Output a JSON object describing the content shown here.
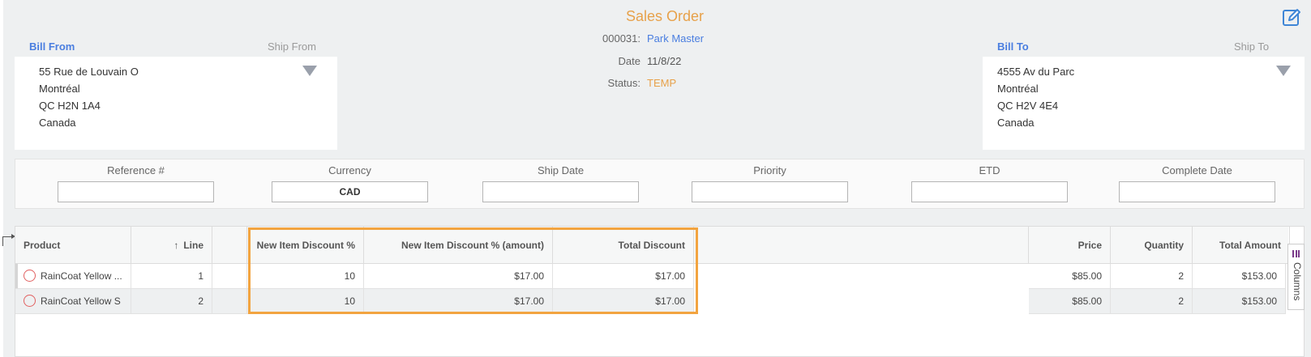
{
  "header": {
    "title": "Sales Order",
    "edit_icon": "edit-icon",
    "order_number_label": "000031:",
    "order_number_value": "Park Master",
    "date_label": "Date",
    "date_value": "11/8/22",
    "status_label": "Status:",
    "status_value": "TEMP"
  },
  "bill_from": {
    "label": "Bill From",
    "ship_from_label": "Ship From",
    "lines": [
      "55 Rue de Louvain O",
      "Montréal",
      "QC H2N 1A4",
      "Canada"
    ]
  },
  "bill_to": {
    "label": "Bill To",
    "ship_to_label": "Ship To",
    "lines": [
      "4555 Av du Parc",
      "Montréal",
      "QC H2V 4E4",
      "Canada"
    ]
  },
  "fields": {
    "reference": {
      "label": "Reference #",
      "value": ""
    },
    "currency": {
      "label": "Currency",
      "value": "CAD"
    },
    "ship_date": {
      "label": "Ship Date",
      "value": ""
    },
    "priority": {
      "label": "Priority",
      "value": ""
    },
    "etd": {
      "label": "ETD",
      "value": ""
    },
    "complete_date": {
      "label": "Complete Date",
      "value": ""
    }
  },
  "grid": {
    "columns": {
      "product": "Product",
      "line": "Line",
      "line_sort": "↑",
      "new_item_discount_pct": "New Item Discount %",
      "new_item_discount_amount": "New Item Discount % (amount)",
      "total_discount": "Total Discount",
      "price": "Price",
      "quantity": "Quantity",
      "total_amount": "Total Amount"
    },
    "rows": [
      {
        "product": "RainCoat Yellow ...",
        "line": "1",
        "discount_pct": "10",
        "discount_amount": "$17.00",
        "total_discount": "$17.00",
        "price": "$85.00",
        "quantity": "2",
        "total_amount": "$153.00"
      },
      {
        "product": "RainCoat Yellow S",
        "line": "2",
        "discount_pct": "10",
        "discount_amount": "$17.00",
        "total_discount": "$17.00",
        "price": "$85.00",
        "quantity": "2",
        "total_amount": "$153.00"
      }
    ],
    "columns_tab_label": "Columns"
  },
  "colors": {
    "accent_orange": "#e7a14a",
    "link_blue": "#4a7ee0",
    "highlight": "#f2a440",
    "status_circle": "#e16060"
  }
}
